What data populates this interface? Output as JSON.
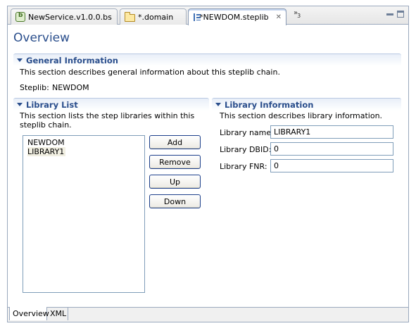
{
  "tabs": [
    {
      "label": "NewService.v1.0.0.bs",
      "icon": "service-file-icon"
    },
    {
      "label": "*.domain",
      "icon": "folder-icon"
    },
    {
      "label": "*NEWDOM.steplib",
      "icon": "steplib-icon"
    }
  ],
  "tab_overflow": {
    "chevron": "»",
    "count": "3"
  },
  "page": {
    "title": "Overview"
  },
  "general": {
    "title": "General Information",
    "description": "This section describes general information about this steplib chain.",
    "steplib_label": "Steplib:",
    "steplib_value": "NEWDOM"
  },
  "library_list": {
    "title": "Library List",
    "description": "This section lists the step libraries within this steplib chain.",
    "items": [
      "NEWDOM",
      "LIBRARY1"
    ],
    "selected_index": 1,
    "buttons": {
      "add": "Add",
      "remove": "Remove",
      "up": "Up",
      "down": "Down"
    }
  },
  "library_info": {
    "title": "Library Information",
    "description": "This section describes library information.",
    "name_label": "Library name:",
    "name_value": "LIBRARY1",
    "dbid_label": "Library DBID:",
    "dbid_value": "0",
    "fnr_label": "Library FNR:",
    "fnr_value": "0"
  },
  "bottom_tabs": [
    "Overview",
    "XML"
  ],
  "colors": {
    "accent": "#2a4e8c",
    "border": "#9aa8bd"
  }
}
